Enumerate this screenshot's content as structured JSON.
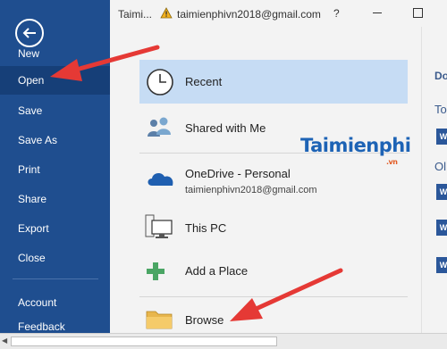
{
  "titlebar": {
    "doc_title": "Taimi...",
    "account_email": "taimienphivn2018@gmail.com",
    "help_label": "?",
    "warning_icon": "warning-icon",
    "restore_icon": "restore-icon"
  },
  "sidebar": {
    "back_icon": "back-arrow-icon",
    "items": [
      {
        "label": "New"
      },
      {
        "label": "Open",
        "active": true
      },
      {
        "label": "Save"
      },
      {
        "label": "Save As"
      },
      {
        "label": "Print"
      },
      {
        "label": "Share"
      },
      {
        "label": "Export"
      },
      {
        "label": "Close"
      },
      {
        "label": "Account"
      },
      {
        "label": "Feedback"
      }
    ]
  },
  "places": [
    {
      "title": "Recent",
      "icon": "clock-icon",
      "active": true
    },
    {
      "title": "Shared with Me",
      "icon": "people-icon"
    },
    {
      "title": "OneDrive - Personal",
      "subtitle": "taimienphivn2018@gmail.com",
      "icon": "cloud-icon"
    },
    {
      "title": "This PC",
      "icon": "computer-icon"
    },
    {
      "title": "Add a Place",
      "icon": "plus-icon"
    },
    {
      "title": "Browse",
      "icon": "folder-icon"
    }
  ],
  "right_panel": {
    "header_fragment": "Do",
    "section1_fragment": "To",
    "section2_fragment": "Ol"
  },
  "watermark": {
    "main": "Taimienphi",
    "suffix": ".vn"
  },
  "colors": {
    "sidebar_bg": "#1f4e8f",
    "sidebar_active": "#163f78",
    "selected_place": "#c6dcf4",
    "arrow": "#e53935"
  }
}
